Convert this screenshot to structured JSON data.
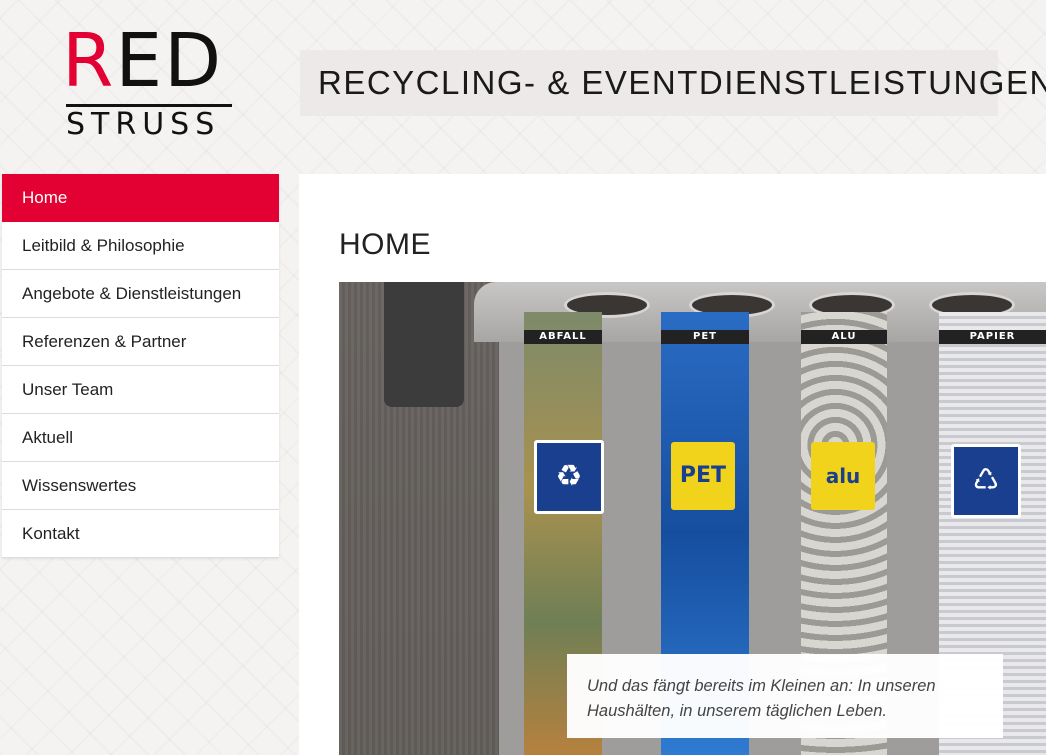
{
  "logo": {
    "top_text": "RED",
    "bottom_text": "STRUSS",
    "accent_color": "#e30032"
  },
  "header": {
    "tagline": "RECYCLING- & EVENTDIENSTLEISTUNGEN"
  },
  "nav": {
    "active_color": "#e30032",
    "items": [
      {
        "label": "Home",
        "active": true
      },
      {
        "label": "Leitbild & Philosophie"
      },
      {
        "label": "Angebote & Dienstleistungen"
      },
      {
        "label": "Referenzen & Partner"
      },
      {
        "label": "Unser Team"
      },
      {
        "label": "Aktuell"
      },
      {
        "label": "Wissenswertes"
      },
      {
        "label": "Kontakt"
      }
    ]
  },
  "main": {
    "title": "HOME",
    "photo": {
      "bin_labels": [
        "ABFALL",
        "PET",
        "ALU",
        "PAPIER"
      ],
      "sign_texts": [
        "PET",
        "alu"
      ],
      "caption": "Und das fängt bereits im Kleinen an: In unseren Haushälten, in unserem täglichen Leben."
    }
  }
}
